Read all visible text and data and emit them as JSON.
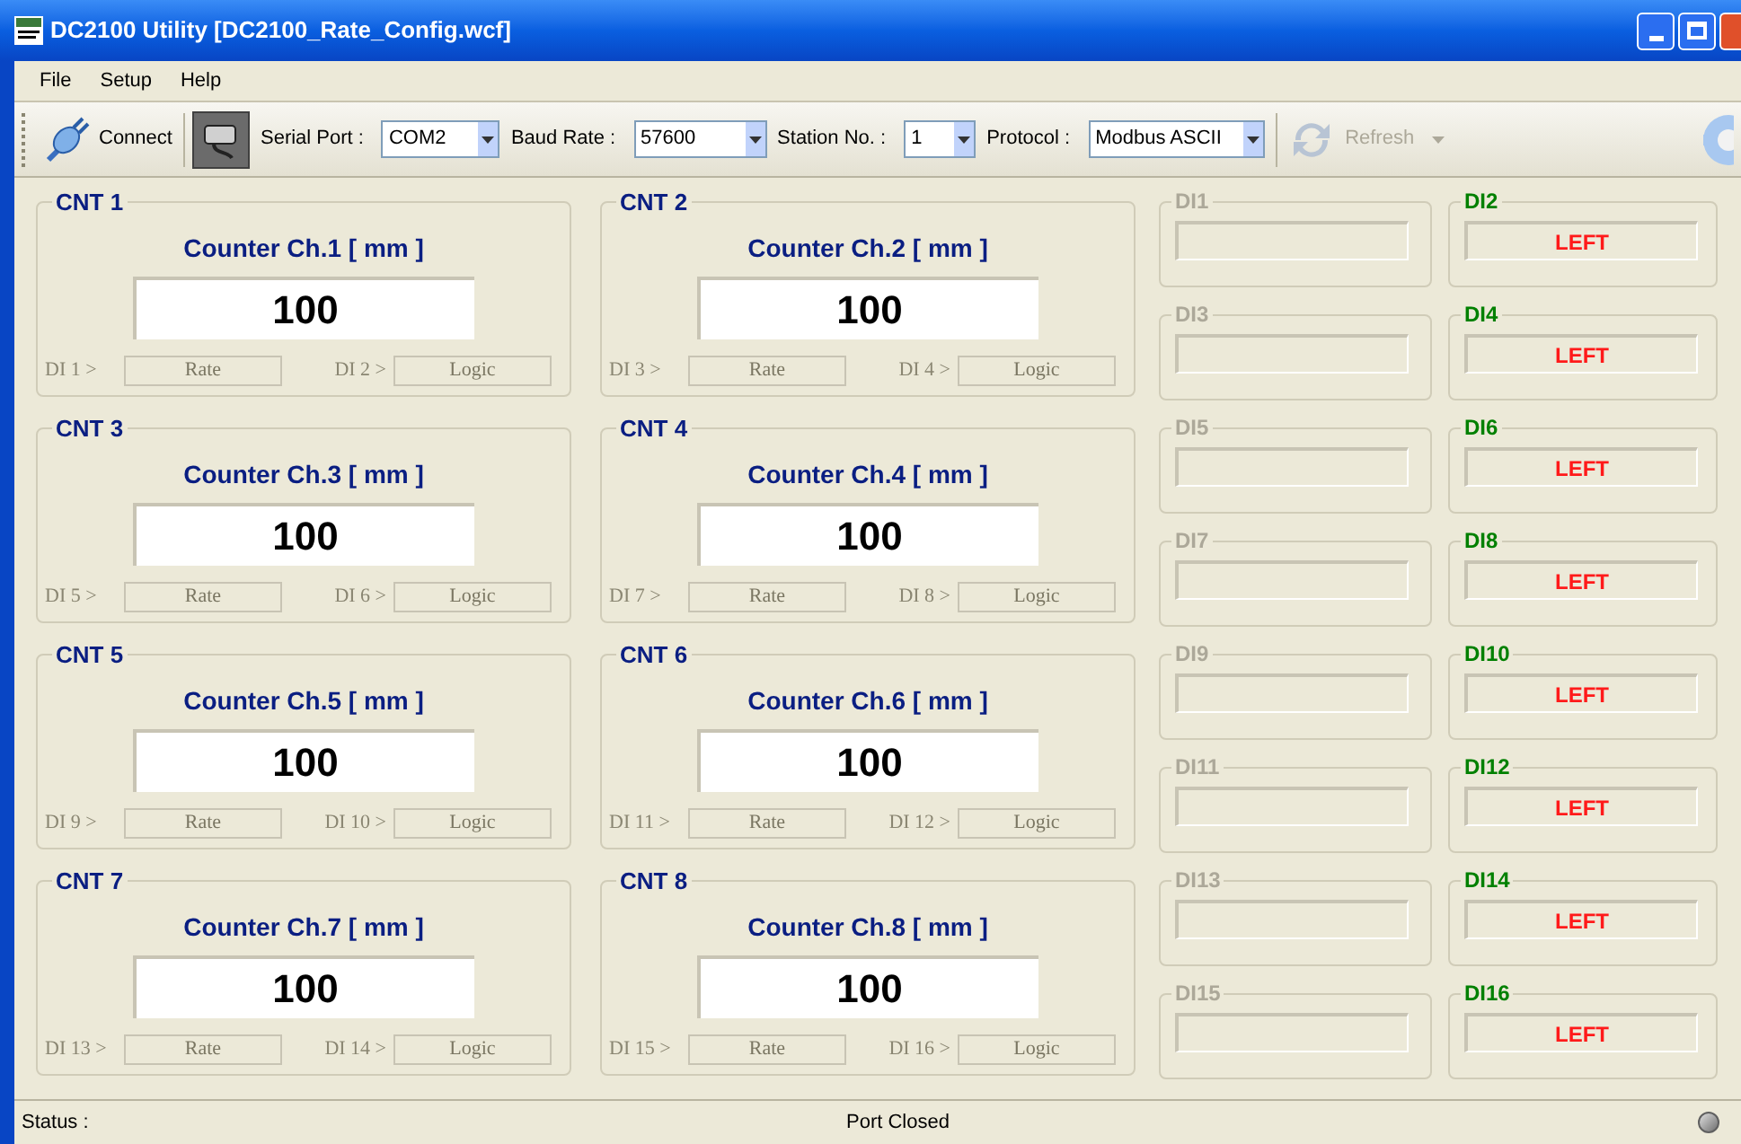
{
  "window": {
    "title": "DC2100 Utility [DC2100_Rate_Config.wcf]"
  },
  "menu": [
    "File",
    "Setup",
    "Help"
  ],
  "toolbar": {
    "connect": "Connect",
    "fields": [
      {
        "label": "Serial Port :",
        "value": "COM2"
      },
      {
        "label": "Baud Rate :",
        "value": "57600"
      },
      {
        "label": "Station No. :",
        "value": "1"
      },
      {
        "label": "Protocol :",
        "value": "Modbus ASCII"
      }
    ],
    "refresh": {
      "label": "Refresh",
      "disabled": true
    }
  },
  "counters": [
    {
      "title": "CNT 1",
      "heading": "Counter Ch.1 [ mm ]",
      "value": "100",
      "inputs": [
        {
          "label": "DI 1 >",
          "mode": "Rate"
        },
        {
          "label": "DI 2 >",
          "mode": "Logic"
        }
      ]
    },
    {
      "title": "CNT 2",
      "heading": "Counter Ch.2 [ mm ]",
      "value": "100",
      "inputs": [
        {
          "label": "DI 3 >",
          "mode": "Rate"
        },
        {
          "label": "DI 4 >",
          "mode": "Logic"
        }
      ]
    },
    {
      "title": "CNT 3",
      "heading": "Counter Ch.3 [ mm ]",
      "value": "100",
      "inputs": [
        {
          "label": "DI 5 >",
          "mode": "Rate"
        },
        {
          "label": "DI 6 >",
          "mode": "Logic"
        }
      ]
    },
    {
      "title": "CNT 4",
      "heading": "Counter Ch.4 [ mm ]",
      "value": "100",
      "inputs": [
        {
          "label": "DI 7 >",
          "mode": "Rate"
        },
        {
          "label": "DI 8 >",
          "mode": "Logic"
        }
      ]
    },
    {
      "title": "CNT 5",
      "heading": "Counter Ch.5 [ mm ]",
      "value": "100",
      "inputs": [
        {
          "label": "DI 9 >",
          "mode": "Rate"
        },
        {
          "label": "DI 10 >",
          "mode": "Logic"
        }
      ]
    },
    {
      "title": "CNT 6",
      "heading": "Counter Ch.6 [ mm ]",
      "value": "100",
      "inputs": [
        {
          "label": "DI 11 >",
          "mode": "Rate"
        },
        {
          "label": "DI 12 >",
          "mode": "Logic"
        }
      ]
    },
    {
      "title": "CNT 7",
      "heading": "Counter Ch.7 [ mm ]",
      "value": "100",
      "inputs": [
        {
          "label": "DI 13 >",
          "mode": "Rate"
        },
        {
          "label": "DI 14 >",
          "mode": "Logic"
        }
      ]
    },
    {
      "title": "CNT 8",
      "heading": "Counter Ch.8 [ mm ]",
      "value": "100",
      "inputs": [
        {
          "label": "DI 15 >",
          "mode": "Rate"
        },
        {
          "label": "DI 16 >",
          "mode": "Logic"
        }
      ]
    }
  ],
  "digital_inputs": [
    {
      "title": "DI1",
      "enabled": false
    },
    {
      "title": "DI2",
      "enabled": true,
      "value": "LEFT"
    },
    {
      "title": "DI3",
      "enabled": false
    },
    {
      "title": "DI4",
      "enabled": true,
      "value": "LEFT"
    },
    {
      "title": "DI5",
      "enabled": false
    },
    {
      "title": "DI6",
      "enabled": true,
      "value": "LEFT"
    },
    {
      "title": "DI7",
      "enabled": false
    },
    {
      "title": "DI8",
      "enabled": true,
      "value": "LEFT"
    },
    {
      "title": "DI9",
      "enabled": false
    },
    {
      "title": "DI10",
      "enabled": true,
      "value": "LEFT"
    },
    {
      "title": "DI11",
      "enabled": false
    },
    {
      "title": "DI12",
      "enabled": true,
      "value": "LEFT"
    },
    {
      "title": "DI13",
      "enabled": false
    },
    {
      "title": "DI14",
      "enabled": true,
      "value": "LEFT"
    },
    {
      "title": "DI15",
      "enabled": false
    },
    {
      "title": "DI16",
      "enabled": true,
      "value": "LEFT"
    }
  ],
  "status_bar": {
    "label": "Status :",
    "message": "Port Closed"
  }
}
